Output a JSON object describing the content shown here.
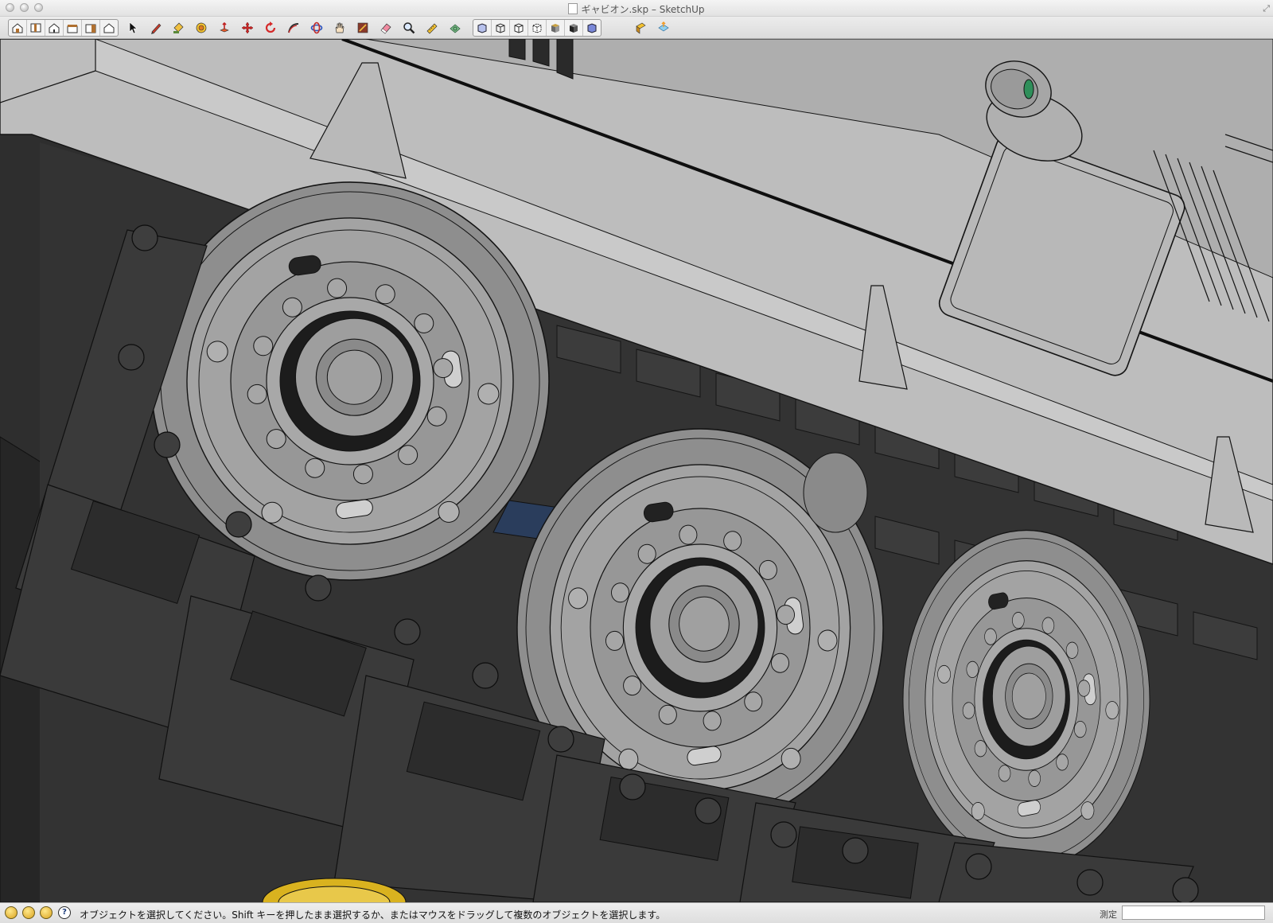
{
  "window": {
    "title": "ギャビオン.skp – SketchUp"
  },
  "toolbar": {
    "views": [
      {
        "name": "iso-view",
        "label": "Iso"
      },
      {
        "name": "top-view",
        "label": "Top"
      },
      {
        "name": "front-view",
        "label": "Front"
      },
      {
        "name": "right-view",
        "label": "Right"
      },
      {
        "name": "back-view",
        "label": "Back"
      },
      {
        "name": "left-view",
        "label": "Left"
      }
    ],
    "tools": [
      {
        "name": "select-tool",
        "icon": "arrow-cursor-icon"
      },
      {
        "name": "line-tool",
        "icon": "pencil-icon"
      },
      {
        "name": "paint-bucket-tool",
        "icon": "paint-bucket-icon"
      },
      {
        "name": "offset-tool",
        "icon": "offset-icon"
      },
      {
        "name": "push-pull-tool",
        "icon": "push-pull-icon"
      },
      {
        "name": "move-tool",
        "icon": "move-arrows-icon"
      },
      {
        "name": "rotate-tool",
        "icon": "rotate-icon"
      },
      {
        "name": "follow-me-tool",
        "icon": "follow-me-icon"
      },
      {
        "name": "orbit-tool",
        "icon": "orbit-icon"
      },
      {
        "name": "pan-tool",
        "icon": "hand-icon"
      },
      {
        "name": "zoom-window-tool",
        "icon": "zoom-window-icon"
      },
      {
        "name": "eraser-tool",
        "icon": "eraser-icon"
      },
      {
        "name": "zoom-tool",
        "icon": "magnifier-icon"
      },
      {
        "name": "tape-measure-tool",
        "icon": "tape-measure-icon"
      },
      {
        "name": "section-tool",
        "icon": "section-icon"
      }
    ],
    "styles": [
      {
        "name": "xray-style"
      },
      {
        "name": "wireframe-style"
      },
      {
        "name": "hidden-line-style"
      },
      {
        "name": "back-edges-style"
      },
      {
        "name": "shaded-style"
      },
      {
        "name": "shaded-textures-style"
      },
      {
        "name": "monochrome-style"
      }
    ],
    "extras": [
      {
        "name": "get-models-button",
        "icon": "warehouse-icon"
      },
      {
        "name": "share-model-button",
        "icon": "share-icon"
      }
    ]
  },
  "statusbar": {
    "icons": [
      "geo-location-icon",
      "credits-icon",
      "signin-icon",
      "help-icon"
    ],
    "help_glyph": "?",
    "message": "オブジェクトを選択してください。Shift キーを押したまま選択するか、またはマウスをドラッグして複数のオブジェクトを選択します。",
    "measure_label": "測定",
    "measure_value": ""
  },
  "colors": {
    "body_light": "#c4c4c4",
    "body_mid": "#a9a9a9",
    "track_dark": "#3a3a3a",
    "wheel": "#9a9a9a",
    "accent_green": "#2f8f5a",
    "accent_yellow": "#d9b21f",
    "accent_blue": "#2a3d5c"
  }
}
